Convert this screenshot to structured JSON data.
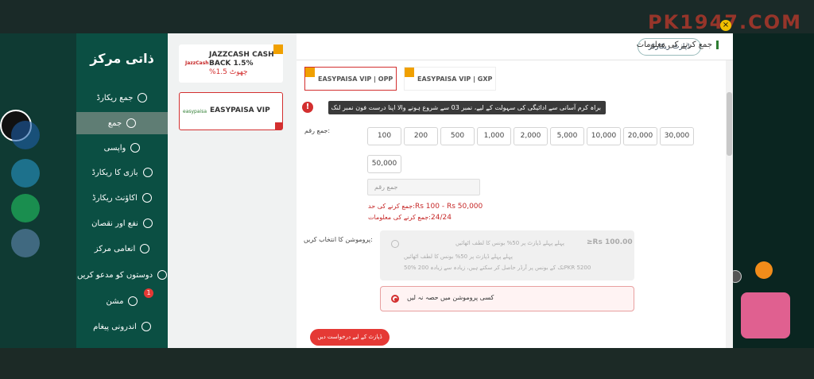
{
  "header": {
    "brand": "PK1947.COM",
    "close_symbol": "×"
  },
  "sidebar": {
    "title": "ذاتی مرکز",
    "items": [
      {
        "label": "جمع ریکارڈ",
        "icon": "receipt-icon"
      },
      {
        "label": "جمع",
        "icon": "deposit-icon"
      },
      {
        "label": "واپسی",
        "icon": "withdraw-icon"
      },
      {
        "label": "بازی کا ریکارڈ",
        "icon": "clipboard-icon"
      },
      {
        "label": "اکاؤنٹ ریکارڈ",
        "icon": "list-icon"
      },
      {
        "label": "نفع اور نقصان",
        "icon": "chart-icon"
      },
      {
        "label": "انعامی مرکز",
        "icon": "gift-icon"
      },
      {
        "label": "دوستوں کو مدعو کریں",
        "icon": "add-user-icon"
      },
      {
        "label": "مشن",
        "icon": "mission-icon"
      },
      {
        "label": "اندرونی پیغام",
        "icon": "at-icon"
      }
    ],
    "mission_badge": "1"
  },
  "channels": [
    {
      "name": "JAZZCASH CASH BACK 1.5%",
      "sub": "%چھوٹ 1.5",
      "logo": "JazzCash"
    },
    {
      "name": "EASYPAISA VIP",
      "logo": "easypaisa"
    }
  ],
  "main": {
    "title": "جمع کرنے کی معلومات",
    "records_button": "ڈپازٹ ریکارڈز",
    "tabs": [
      "EASYPAISA VIP | OPP",
      "EASYPAISA VIP | GXP"
    ],
    "warning": "براہ کرم آسانی سے ادائیگی کی سہولت کے لیے، نمبر 03 سے شروع ہونے والا اپنا درست فون نمبر لنک کریں۔",
    "amount_label": "جمع رقم:",
    "amounts": [
      "100",
      "200",
      "500",
      "1,000",
      "2,000",
      "5,000",
      "10,000",
      "20,000",
      "30,000",
      "50,000"
    ],
    "amount_placeholder": "جمع رقم",
    "limit_label": "جمع کرنے کی حد:",
    "limit_value": "Rs 100 - Rs 50,000",
    "info_label": "جمع کرنے کی معلومات:",
    "info_value": "24/24",
    "promo_label": "پروموشن کا انتخاب کریں:",
    "promo1": {
      "amount": "≥Rs 100.00",
      "line1": "پہلے پہلے ڈپازٹ پر 50% بونس کا لطف اٹھائیں",
      "line2": "پہلے پہلے ڈپازٹ پر 50% بونس کا لطف اٹھائیں",
      "line3": "50% تک کے بونس پر آرڈر حاصل کر سکتے ہیں، زیادہ سے زیادہ 200PKR 5200"
    },
    "promo2": "کسی پروموشن میں حصہ نہ لیں",
    "submit": "ڈپازٹ کے لیے درخواست دیں"
  },
  "colors": {
    "accent": "#d32f2f",
    "sidebar": "#0b4f43",
    "tip": "#3a3a3a"
  }
}
